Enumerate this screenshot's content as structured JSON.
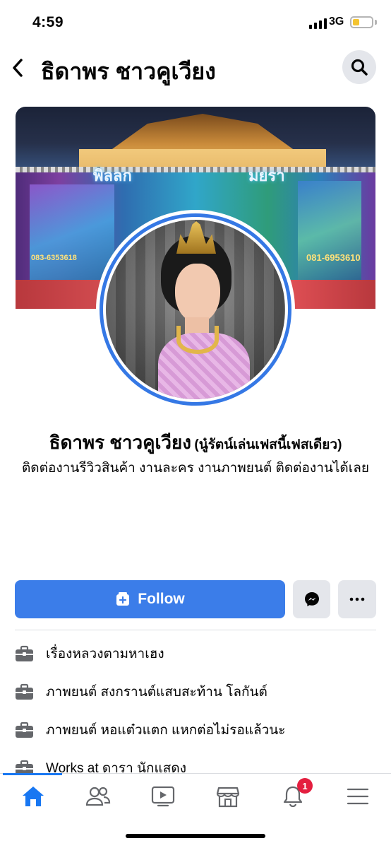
{
  "status_bar": {
    "time": "4:59",
    "network": "3G",
    "battery_level": 0.3
  },
  "header": {
    "title": "ธิดาพร ชาวคูเวียง"
  },
  "cover": {
    "text_left": "พิลลก",
    "text_right": "มยรา",
    "phone_left": "083-6353618",
    "phone_right": "081-6953610"
  },
  "profile": {
    "name": "ธิดาพร ชาวคูเวียง",
    "alternate_name": "(นู๋รัตน์เล่นเฟสนี้เฟสเดียว)",
    "bio": "ติดต่องานรีวิวสินค้า งานละคร งานภาพยนต์ ติดต่องานได้เลย"
  },
  "actions": {
    "follow_label": "Follow"
  },
  "work_items": [
    {
      "label": "เรื่องหลวงตามหาเฮง"
    },
    {
      "label": "ภาพยนต์ สงกรานต์แสบสะท้าน โลกันต์"
    },
    {
      "label": "ภาพยนต์ หอแต๋วแตก แหกต่อไม่รอแล้วนะ"
    },
    {
      "label": "Works at ดารา นักแสดง"
    }
  ],
  "bottom_nav": {
    "notification_count": "1",
    "active_tab": "home"
  },
  "colors": {
    "accent": "#1877f2",
    "follow_button": "#3b7de9",
    "badge": "#e41e3f",
    "button_grey": "#e4e6eb"
  }
}
